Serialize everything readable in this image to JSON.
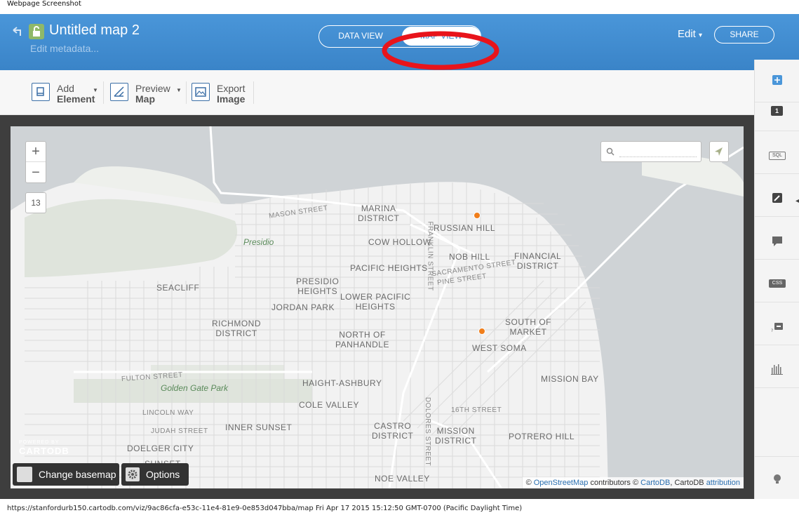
{
  "caption": "Webpage Screenshot",
  "header": {
    "title": "Untitled map 2",
    "edit_metadata": "Edit metadata...",
    "data_view": "DATA VIEW",
    "map_view": "MAP VIEW",
    "edit": "Edit",
    "edit_caret": "▾",
    "share": "SHARE"
  },
  "toolbar": {
    "add_line1": "Add",
    "add_line2": "Element",
    "preview_line1": "Preview",
    "preview_line2": "Map",
    "export_line1": "Export",
    "export_line2": "Image",
    "caret": "▼"
  },
  "map": {
    "zoom_in": "+",
    "zoom_out": "−",
    "zoom_level": "13",
    "search_placeholder": "",
    "powered_by": "POWERED BY",
    "brand": "CARTODB",
    "change_basemap": "Change basemap",
    "options": "Options",
    "attribution": {
      "prefix": "© ",
      "osm": "OpenStreetMap",
      "mid": " contributors © ",
      "cartodb": "CartoDB",
      "mid2": ", CartoDB ",
      "attr": "attribution"
    },
    "labels": {
      "marina": "MARINA\nDISTRICT",
      "russian_hill": "RUSSIAN HILL",
      "cow_hollow": "COW HOLLOW",
      "nob_hill": "NOB HILL",
      "financial": "FINANCIAL\nDISTRICT",
      "presidio": "Presidio",
      "pacific_heights": "PACIFIC HEIGHTS",
      "seacliff": "SEACLIFF",
      "presidio_heights": "PRESIDIO\nHEIGHTS",
      "lower_pacific": "LOWER PACIFIC\nHEIGHTS",
      "jordan_park": "JORDAN PARK",
      "richmond": "RICHMOND\nDISTRICT",
      "north_panhandle": "NORTH OF\nPANHANDLE",
      "south_market": "SOUTH OF\nMARKET",
      "west_soma": "WEST SOMA",
      "haight": "HAIGHT-ASHBURY",
      "golden_gate": "Golden Gate Park",
      "cole_valley": "COLE VALLEY",
      "mission_bay": "MISSION BAY",
      "inner_sunset": "INNER SUNSET",
      "castro": "CASTRO\nDISTRICT",
      "mission": "MISSION\nDISTRICT",
      "potrero": "POTRERO HILL",
      "doelger": "DOELGER CITY",
      "sunset": "SUNSET",
      "noe_valley": "NOE VALLEY",
      "mason_st": "MASON STREET",
      "fulton_st": "FULTON STREET",
      "lincoln_way": "LINCOLN WAY",
      "judah_st": "JUDAH STREET",
      "franklin_st": "FRANKLIN STREET",
      "sacramento_st": "SACRAMENTO STREET",
      "pine_st": "PINE STREET",
      "sixteenth_st": "16TH STREET",
      "dolores_st": "DOLORES STREET"
    },
    "marker_color": "#f07e1b"
  },
  "right_panel": {
    "layer_count": "1",
    "sql": "SQL",
    "css": "CSS"
  },
  "footer": {
    "url": "https://stanfordurb150.cartodb.com/viz/9ac86cfa-e53c-11e4-81e9-0e853d047bba/map Fri Apr 17 2015 15:12:50 GMT-0700 (Pacific Daylight Time)"
  },
  "colors": {
    "header": "#3a84c8",
    "highlight": "#e8141b",
    "park": "#dfe4dc",
    "land": "#f2f2f2",
    "water": "#cfd3d6"
  }
}
